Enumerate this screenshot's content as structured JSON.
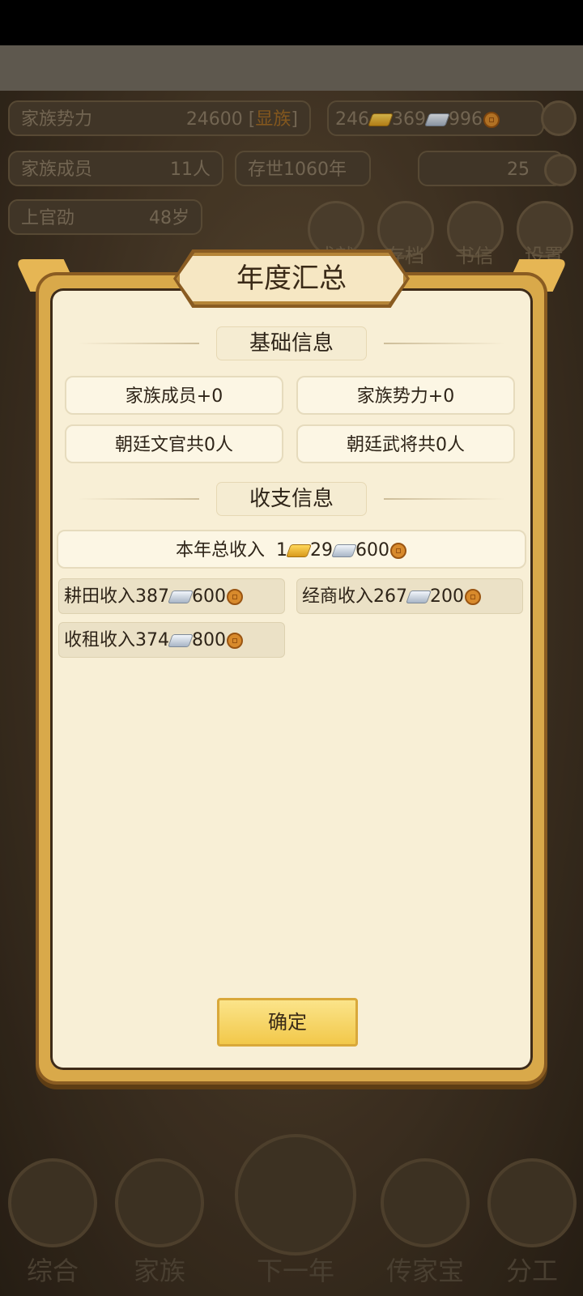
{
  "hud": {
    "family_power_label": "家族势力",
    "family_power_value": "24600",
    "family_rank": "显族",
    "currency_gold": "246",
    "currency_silver": "369",
    "currency_coin": "996",
    "family_members_label": "家族成员",
    "family_members_value": "11人",
    "existence": "存世1060年",
    "ingot_count": "25",
    "leader_name": "上官劭",
    "leader_age": "48岁",
    "round_buttons": [
      "成就",
      "存档",
      "书信",
      "设置"
    ]
  },
  "bottom_nav": [
    "综合",
    "家族",
    "下一年",
    "传家宝",
    "分工"
  ],
  "modal": {
    "title": "年度汇总",
    "section_basic": "基础信息",
    "basic_items": [
      "家族成员+0",
      "家族势力+0",
      "朝廷文官共0人",
      "朝廷武将共0人"
    ],
    "section_income": "收支信息",
    "total_income": {
      "label": "本年总收入",
      "gold": "1",
      "silver": "29",
      "coin": "600"
    },
    "income_items": [
      {
        "label": "耕田收入387",
        "coin": "600"
      },
      {
        "label": "经商收入267",
        "coin": "200"
      },
      {
        "label": "收租收入374",
        "coin": "800"
      }
    ],
    "confirm_label": "确定"
  }
}
